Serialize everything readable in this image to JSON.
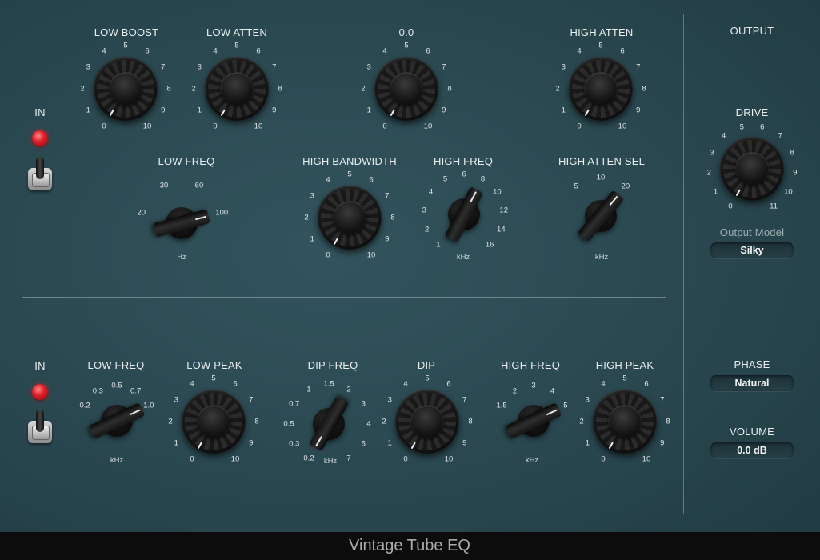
{
  "window": {
    "title": "Vintage Tube EQ"
  },
  "top": {
    "in_label": "IN",
    "low_boost": {
      "label": "LOW BOOST",
      "ticks": [
        "0",
        "1",
        "2",
        "3",
        "4",
        "5",
        "6",
        "7",
        "8",
        "9",
        "10"
      ],
      "value": 0
    },
    "low_atten": {
      "label": "LOW ATTEN",
      "ticks": [
        "0",
        "1",
        "2",
        "3",
        "4",
        "5",
        "6",
        "7",
        "8",
        "9",
        "10"
      ],
      "value": 0
    },
    "high_boost": {
      "label": "0.0",
      "ticks": [
        "0",
        "1",
        "2",
        "3",
        "4",
        "5",
        "6",
        "7",
        "8",
        "9",
        "10"
      ],
      "value": 0
    },
    "high_atten": {
      "label": "HIGH ATTEN",
      "ticks": [
        "0",
        "1",
        "2",
        "3",
        "4",
        "5",
        "6",
        "7",
        "8",
        "9",
        "10"
      ],
      "value": 0
    },
    "low_freq": {
      "label": "LOW FREQ",
      "ticks": [
        "20",
        "30",
        "60",
        "100"
      ],
      "unit": "Hz",
      "value": "100"
    },
    "high_bandwidth": {
      "label": "HIGH BANDWIDTH",
      "ticks": [
        "0",
        "1",
        "2",
        "3",
        "4",
        "5",
        "6",
        "7",
        "8",
        "9",
        "10"
      ],
      "value": 0
    },
    "high_freq": {
      "label": "HIGH FREQ",
      "ticks": [
        "1",
        "2",
        "3",
        "4",
        "5",
        "6",
        "8",
        "10",
        "12",
        "14",
        "16"
      ],
      "unit": "kHz",
      "value": "8"
    },
    "high_atten_sel": {
      "label": "HIGH ATTEN SEL",
      "ticks": [
        "5",
        "10",
        "20"
      ],
      "unit": "kHz",
      "value": "20"
    }
  },
  "bottom": {
    "in_label": "IN",
    "low_freq": {
      "label": "LOW FREQ",
      "ticks": [
        "0.2",
        "0.3",
        "0.5",
        "0.7",
        "1.0"
      ],
      "unit": "kHz",
      "value": "1.0"
    },
    "low_peak": {
      "label": "LOW PEAK",
      "ticks": [
        "0",
        "1",
        "2",
        "3",
        "4",
        "5",
        "6",
        "7",
        "8",
        "9",
        "10"
      ],
      "value": 0
    },
    "dip_freq": {
      "label": "DIP FREQ",
      "ticks": [
        "0.2",
        "0.3",
        "0.5",
        "0.7",
        "1",
        "1.5",
        "2",
        "3",
        "4",
        "5",
        "7"
      ],
      "unit": "kHz",
      "value": "0.2"
    },
    "dip": {
      "label": "DIP",
      "ticks": [
        "0",
        "1",
        "2",
        "3",
        "4",
        "5",
        "6",
        "7",
        "8",
        "9",
        "10"
      ],
      "value": 0
    },
    "high_freq": {
      "label": "HIGH FREQ",
      "ticks": [
        "1.5",
        "2",
        "3",
        "4",
        "5"
      ],
      "unit": "kHz",
      "value": "5"
    },
    "high_peak": {
      "label": "HIGH PEAK",
      "ticks": [
        "0",
        "1",
        "2",
        "3",
        "4",
        "5",
        "6",
        "7",
        "8",
        "9",
        "10"
      ],
      "value": 0
    }
  },
  "output": {
    "title": "OUTPUT",
    "drive": {
      "label": "DRIVE",
      "ticks": [
        "0",
        "1",
        "2",
        "3",
        "4",
        "5",
        "6",
        "7",
        "8",
        "9",
        "10",
        "11"
      ],
      "value": 0
    },
    "model": {
      "label": "Output Model",
      "value": "Silky"
    },
    "phase": {
      "label": "PHASE",
      "value": "Natural"
    },
    "volume": {
      "label": "VOLUME",
      "value": "0.0 dB"
    }
  }
}
